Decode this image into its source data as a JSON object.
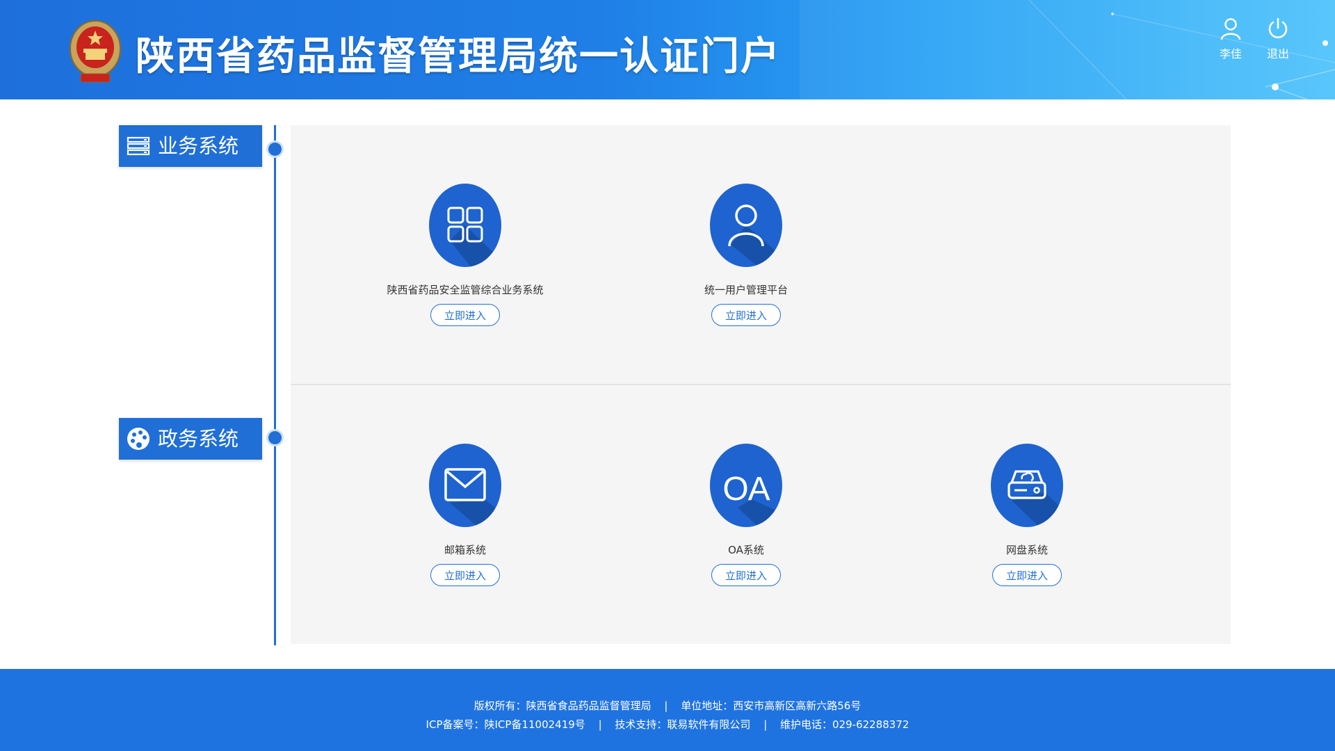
{
  "header": {
    "title": "陕西省药品监督管理局统一认证门户",
    "user_label": "李佳",
    "logout_label": "退出",
    "colors": {
      "gradient_start": "#1e6fdc",
      "gradient_end": "#4fc3fb"
    }
  },
  "sections": [
    {
      "label": "业务系统",
      "icon": "server-list-icon",
      "systems": [
        {
          "name": "陕西省药品安全监管综合业务系统",
          "icon": "grid-apps-icon",
          "button": "立即进入"
        },
        {
          "name": "统一用户管理平台",
          "icon": "user-icon",
          "button": "立即进入"
        }
      ]
    },
    {
      "label": "政务系统",
      "icon": "palette-icon",
      "systems": [
        {
          "name": "邮箱系统",
          "icon": "mail-icon",
          "button": "立即进入"
        },
        {
          "name": "OA系统",
          "icon": "oa-text-icon",
          "icon_text": "OA",
          "button": "立即进入"
        },
        {
          "name": "网盘系统",
          "icon": "cloud-drive-icon",
          "button": "立即进入"
        }
      ]
    }
  ],
  "footer": {
    "copyright": "版权所有：陕西省食品药品监督管理局",
    "address": "单位地址：西安市高新区高新六路56号",
    "icp": "ICP备案号：陕ICP备11002419号",
    "support": "技术支持：联易软件有限公司",
    "phone": "维护电话：029-62288372",
    "separator": "|"
  },
  "colors": {
    "primary": "#1f6fd6",
    "panel_bg": "#f5f5f5",
    "footer_bg": "#1f73e0"
  }
}
